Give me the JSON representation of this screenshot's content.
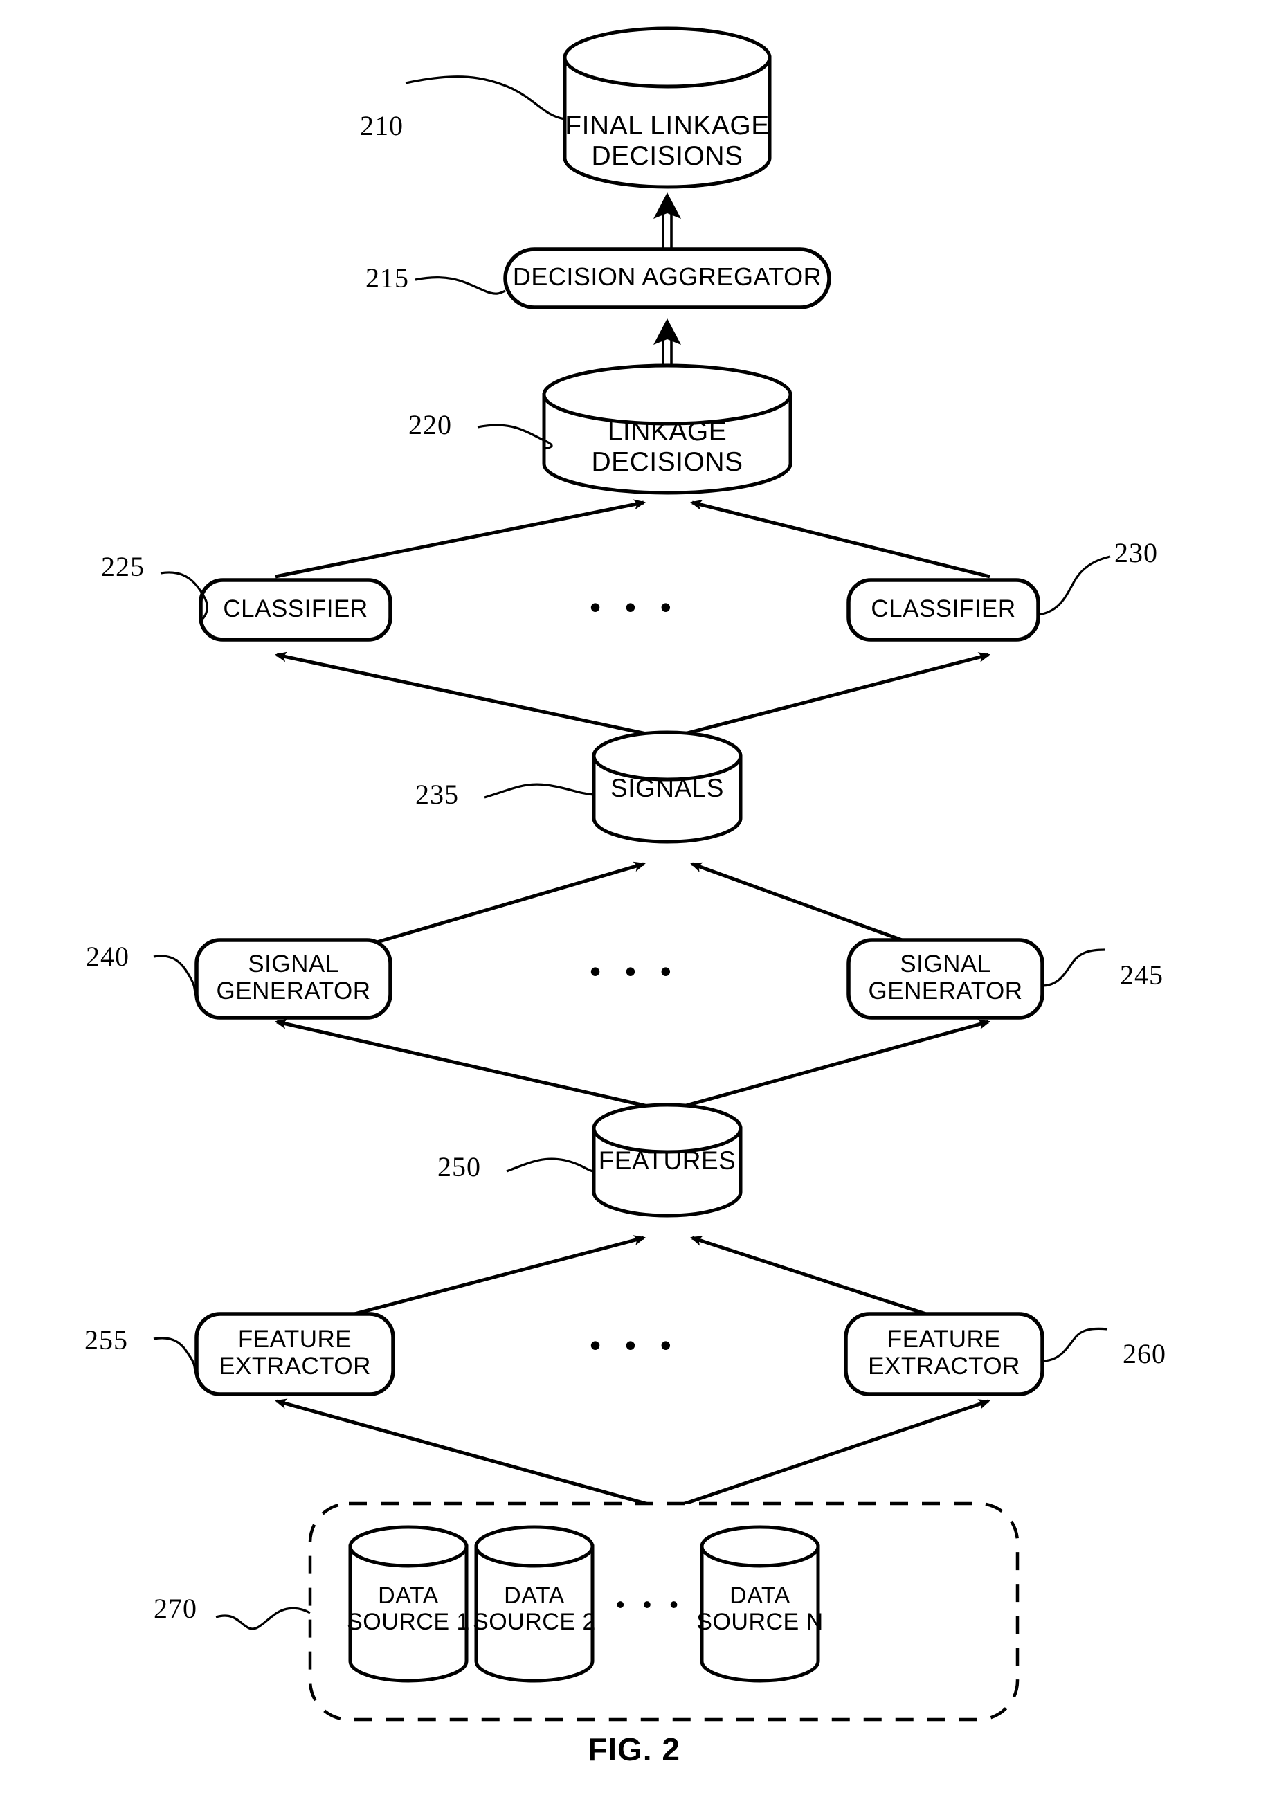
{
  "figure": {
    "caption": "FIG. 2",
    "background_color": "#ffffff",
    "line_color": "#000000"
  },
  "nodes": {
    "final_linkage_decisions": {
      "ref": "210",
      "label": "FINAL LINKAGE\nDECISIONS",
      "shape": "cylinder"
    },
    "decision_aggregator": {
      "ref": "215",
      "label": "DECISION AGGREGATOR",
      "shape": "rounded-rect"
    },
    "linkage_decisions": {
      "ref": "220",
      "label": "LINKAGE DECISIONS",
      "shape": "cylinder"
    },
    "classifier_left": {
      "ref": "225",
      "label": "CLASSIFIER",
      "shape": "rounded-rect"
    },
    "classifier_right": {
      "ref": "230",
      "label": "CLASSIFIER",
      "shape": "rounded-rect"
    },
    "signals": {
      "ref": "235",
      "label": "SIGNALS",
      "shape": "cylinder"
    },
    "signal_generator_left": {
      "ref": "240",
      "label": "SIGNAL\nGENERATOR",
      "shape": "rounded-rect"
    },
    "signal_generator_right": {
      "ref": "245",
      "label": "SIGNAL\nGENERATOR",
      "shape": "rounded-rect"
    },
    "features": {
      "ref": "250",
      "label": "FEATURES",
      "shape": "cylinder"
    },
    "feature_extractor_left": {
      "ref": "255",
      "label": "FEATURE\nEXTRACTOR",
      "shape": "rounded-rect"
    },
    "feature_extractor_right": {
      "ref": "260",
      "label": "FEATURE\nEXTRACTOR",
      "shape": "rounded-rect"
    },
    "data_sources_group": {
      "ref": "270",
      "label": "",
      "shape": "dashed-rounded-rect"
    },
    "data_source_1": {
      "label": "DATA\nSOURCE 1",
      "shape": "cylinder"
    },
    "data_source_2": {
      "label": "DATA\nSOURCE 2",
      "shape": "cylinder"
    },
    "data_source_n": {
      "label": "DATA\nSOURCE N",
      "shape": "cylinder"
    }
  },
  "ellipses": {
    "classifier_row": "• • •",
    "signal_generator_row": "• • •",
    "feature_extractor_row": "• • •",
    "data_source_row": "• • •"
  }
}
